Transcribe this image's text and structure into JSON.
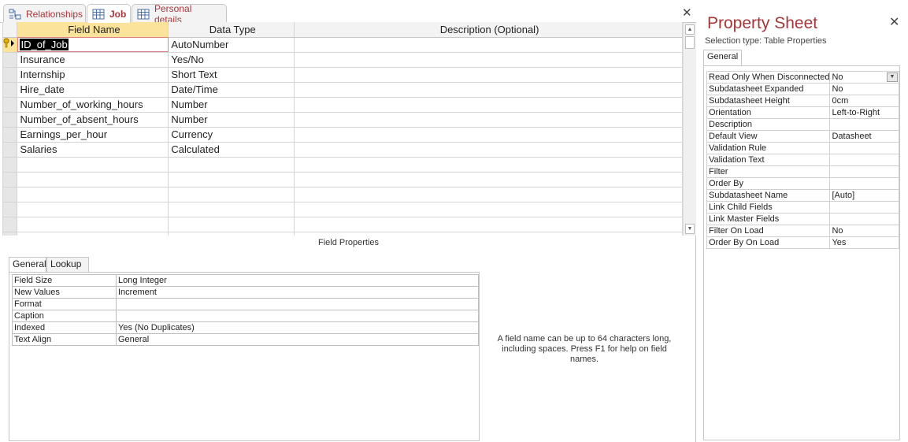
{
  "tabs": [
    {
      "label": "Relationships",
      "icon": "relationships-icon"
    },
    {
      "label": "Job",
      "icon": "table-icon",
      "active": true
    },
    {
      "label": "Personal details",
      "icon": "table-icon"
    }
  ],
  "grid": {
    "headers": {
      "field_name": "Field Name",
      "data_type": "Data Type",
      "description": "Description (Optional)"
    },
    "rows": [
      {
        "name": "ID_of_Job",
        "type": "AutoNumber",
        "key": true
      },
      {
        "name": "Insurance",
        "type": "Yes/No"
      },
      {
        "name": "Internship",
        "type": "Short Text"
      },
      {
        "name": "Hire_date",
        "type": "Date/Time"
      },
      {
        "name": "Number_of_working_hours",
        "type": "Number"
      },
      {
        "name": "Number_of_absent_hours",
        "type": "Number"
      },
      {
        "name": "Earnings_per_hour",
        "type": "Currency"
      },
      {
        "name": "Salaries",
        "type": "Calculated"
      }
    ]
  },
  "field_properties": {
    "title": "Field Properties",
    "tabs": [
      "General",
      "Lookup"
    ],
    "rows": [
      {
        "label": "Field Size",
        "value": "Long Integer"
      },
      {
        "label": "New Values",
        "value": "Increment"
      },
      {
        "label": "Format",
        "value": ""
      },
      {
        "label": "Caption",
        "value": ""
      },
      {
        "label": "Indexed",
        "value": "Yes (No Duplicates)"
      },
      {
        "label": "Text Align",
        "value": "General"
      }
    ],
    "hint": "A field name can be up to 64 characters long, including spaces. Press F1 for help on field names."
  },
  "property_sheet": {
    "title": "Property Sheet",
    "selection_type": "Selection type:  Table Properties",
    "tab": "General",
    "rows": [
      {
        "label": "Read Only When Disconnected",
        "value": "No",
        "dropdown": true
      },
      {
        "label": "Subdatasheet Expanded",
        "value": "No"
      },
      {
        "label": "Subdatasheet Height",
        "value": "0cm"
      },
      {
        "label": "Orientation",
        "value": "Left-to-Right"
      },
      {
        "label": "Description",
        "value": ""
      },
      {
        "label": "Default View",
        "value": "Datasheet"
      },
      {
        "label": "Validation Rule",
        "value": ""
      },
      {
        "label": "Validation Text",
        "value": ""
      },
      {
        "label": "Filter",
        "value": ""
      },
      {
        "label": "Order By",
        "value": ""
      },
      {
        "label": "Subdatasheet Name",
        "value": "[Auto]"
      },
      {
        "label": "Link Child Fields",
        "value": ""
      },
      {
        "label": "Link Master Fields",
        "value": ""
      },
      {
        "label": "Filter On Load",
        "value": "No"
      },
      {
        "label": "Order By On Load",
        "value": "Yes"
      }
    ]
  },
  "icons": {
    "close": "close-icon",
    "scroll_up": "scroll-up-icon",
    "scroll_down": "scroll-down-icon",
    "key": "primary-key-icon"
  },
  "colors": {
    "accent": "#a4373a",
    "selected_header": "#fbe39b"
  }
}
